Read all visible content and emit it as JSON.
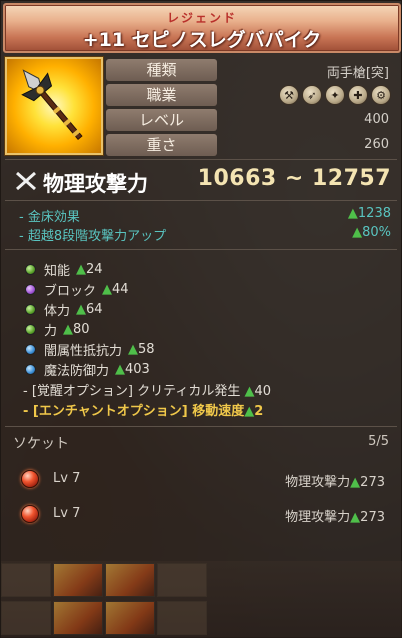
{
  "item": {
    "rarity": "レジェンド",
    "name": "+11 セピノスレグバパイク",
    "icon": "golden-pike-icon"
  },
  "info": {
    "type_label": "種類",
    "type_value": "両手槍[突]",
    "class_label": "職業",
    "class_icons": [
      "warrior-class-icon",
      "archer-class-icon",
      "sorceress-class-icon",
      "cleric-class-icon",
      "academic-class-icon"
    ],
    "level_label": "レベル",
    "level_value": "400",
    "weight_label": "重さ",
    "weight_value": "260"
  },
  "attack": {
    "label": "物理攻撃力",
    "value": "10663 ~ 12757",
    "icon": "crossed-swords-icon"
  },
  "bonuses": [
    {
      "label": "- 金床効果",
      "value": "▲1238"
    },
    {
      "label": "- 超越8段階攻撃力アップ",
      "value": "▲80%"
    }
  ],
  "stats": [
    {
      "orb": "green",
      "label": "知能",
      "value": "▲24"
    },
    {
      "orb": "purple",
      "label": "ブロック",
      "value": "▲44"
    },
    {
      "orb": "green",
      "label": "体力",
      "value": "▲64"
    },
    {
      "orb": "green",
      "label": "力",
      "value": "▲80"
    },
    {
      "orb": "blue",
      "label": "闇属性抵抗力",
      "value": "▲58"
    },
    {
      "orb": "blue",
      "label": "魔法防御力",
      "value": "▲403"
    }
  ],
  "awakening": "- [覚醒オプション] クリティカル発生 ▲40",
  "enchant": "- [エンチャントオプション] 移動速度▲2",
  "socket": {
    "title": "ソケット",
    "count": "5/5",
    "gems": [
      {
        "level": "Lv 7",
        "stat": "物理攻撃力▲273"
      },
      {
        "level": "Lv 7",
        "stat": "物理攻撃力▲273"
      }
    ]
  },
  "colors": {
    "rarity": "#b9302b",
    "attack_value": "#f4e4b2",
    "bonus_text": "#59c4c0",
    "enchant_text": "#f0c84a",
    "increase_triangle": "#4fbf4a"
  }
}
